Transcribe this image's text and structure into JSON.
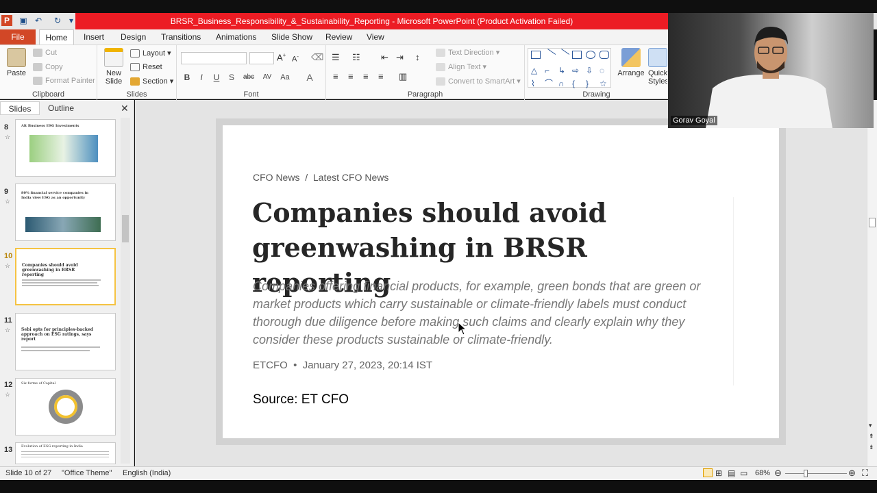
{
  "window": {
    "title": "BRSR_Business_Responsibility_&_Sustainability_Reporting  -  Microsoft PowerPoint (Product Activation Failed)"
  },
  "tabs": [
    "File",
    "Home",
    "Insert",
    "Design",
    "Transitions",
    "Animations",
    "Slide Show",
    "Review",
    "View"
  ],
  "ribbon": {
    "clipboard": {
      "label": "Clipboard",
      "paste": "Paste",
      "cut": "Cut",
      "copy": "Copy",
      "format_painter": "Format Painter"
    },
    "slides": {
      "label": "Slides",
      "new_slide_1": "New",
      "new_slide_2": "Slide",
      "layout": "Layout",
      "reset": "Reset",
      "section": "Section"
    },
    "font": {
      "label": "Font",
      "bold": "B",
      "italic": "I",
      "underline": "U",
      "shadow": "S",
      "strike": "abc",
      "spacing": "AV",
      "case": "Aa"
    },
    "paragraph": {
      "label": "Paragraph",
      "text_direction": "Text Direction",
      "align_text": "Align Text",
      "smartart": "Convert to SmartArt"
    },
    "drawing": {
      "label": "Drawing",
      "arrange": "Arrange",
      "quick_styles_1": "Quick",
      "quick_styles_2": "Styles"
    }
  },
  "pane": {
    "tabs": [
      "Slides",
      "Outline"
    ],
    "thumbs": [
      {
        "num": "8",
        "title": "Alt Business ESG Investments"
      },
      {
        "num": "9",
        "title": "80% financial service companies in India view ESG as an opportunity"
      },
      {
        "num": "10",
        "title": "Companies should avoid greenwashing in BRSR reporting"
      },
      {
        "num": "11",
        "title": "Sebi opts for principles-backed approach on ESG ratings, says report"
      },
      {
        "num": "12",
        "title": "Six forms of Capital"
      },
      {
        "num": "13",
        "title": "Evolution of ESG reporting in India"
      }
    ]
  },
  "slide": {
    "breadcrumb": "CFO News  /  Latest CFO News",
    "headline": "Companies should avoid greenwashing in BRSR reporting",
    "summary": "Companies offering financial products, for example, green bonds that are green or market products which carry sustainable or climate-friendly labels must conduct thorough due diligence before making such claims and clearly explain why they consider these products sustainable or climate-friendly.",
    "byline": "ETCFO  •  January 27, 2023, 20:14 IST",
    "source": "Source: ET CFO"
  },
  "status": {
    "slide": "Slide 10 of 27",
    "theme": "\"Office Theme\"",
    "language": "English (India)",
    "zoom": "68%"
  },
  "webcam": {
    "name": "Gorav Goyal"
  }
}
